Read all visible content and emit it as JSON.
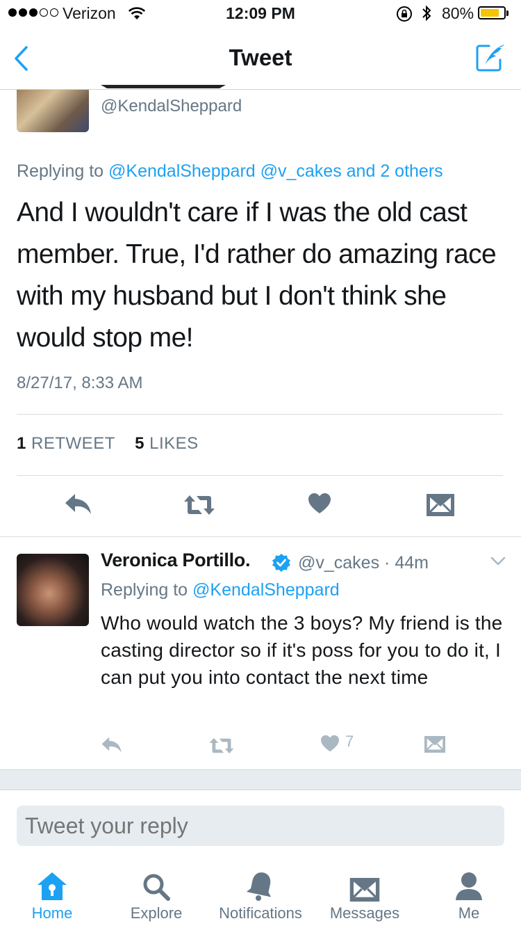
{
  "status_bar": {
    "carrier": "Verizon",
    "time": "12:09 PM",
    "battery_percent": "80%",
    "battery_level": 0.8
  },
  "nav": {
    "title": "Tweet"
  },
  "tweet": {
    "handle": "@KendalSheppard",
    "replying_prefix": "Replying to",
    "replying_to": "@KendalSheppard @v_cakes and 2 others",
    "text": "And I wouldn't care if I was the old cast member. True, I'd rather do amazing race with my husband but I don't think she would stop me!",
    "timestamp": "8/27/17, 8:33 AM",
    "retweets_count": "1",
    "retweets_label": "RETWEET",
    "likes_count": "5",
    "likes_label": "LIKES"
  },
  "reply": {
    "name": "Veronica Portillo.",
    "handle": "@v_cakes",
    "time": "· 44m",
    "replying_prefix": "Replying to",
    "replying_to": "@KendalSheppard",
    "text": "Who would watch the 3 boys? My friend is the casting director so if it's poss for you to do it, I can put you into contact the next time",
    "like_count": "7"
  },
  "composer": {
    "placeholder": "Tweet your reply"
  },
  "tabs": [
    {
      "label": "Home",
      "icon": "home-icon",
      "active": true
    },
    {
      "label": "Explore",
      "icon": "search-icon"
    },
    {
      "label": "Notifications",
      "icon": "bell-icon"
    },
    {
      "label": "Messages",
      "icon": "envelope-icon"
    },
    {
      "label": "Me",
      "icon": "person-icon"
    }
  ],
  "colors": {
    "accent": "#1da1f2",
    "secondary_text": "#657786",
    "icon_gray": "#657786",
    "icon_light": "#aab8c2",
    "battery": "#f5c400"
  }
}
